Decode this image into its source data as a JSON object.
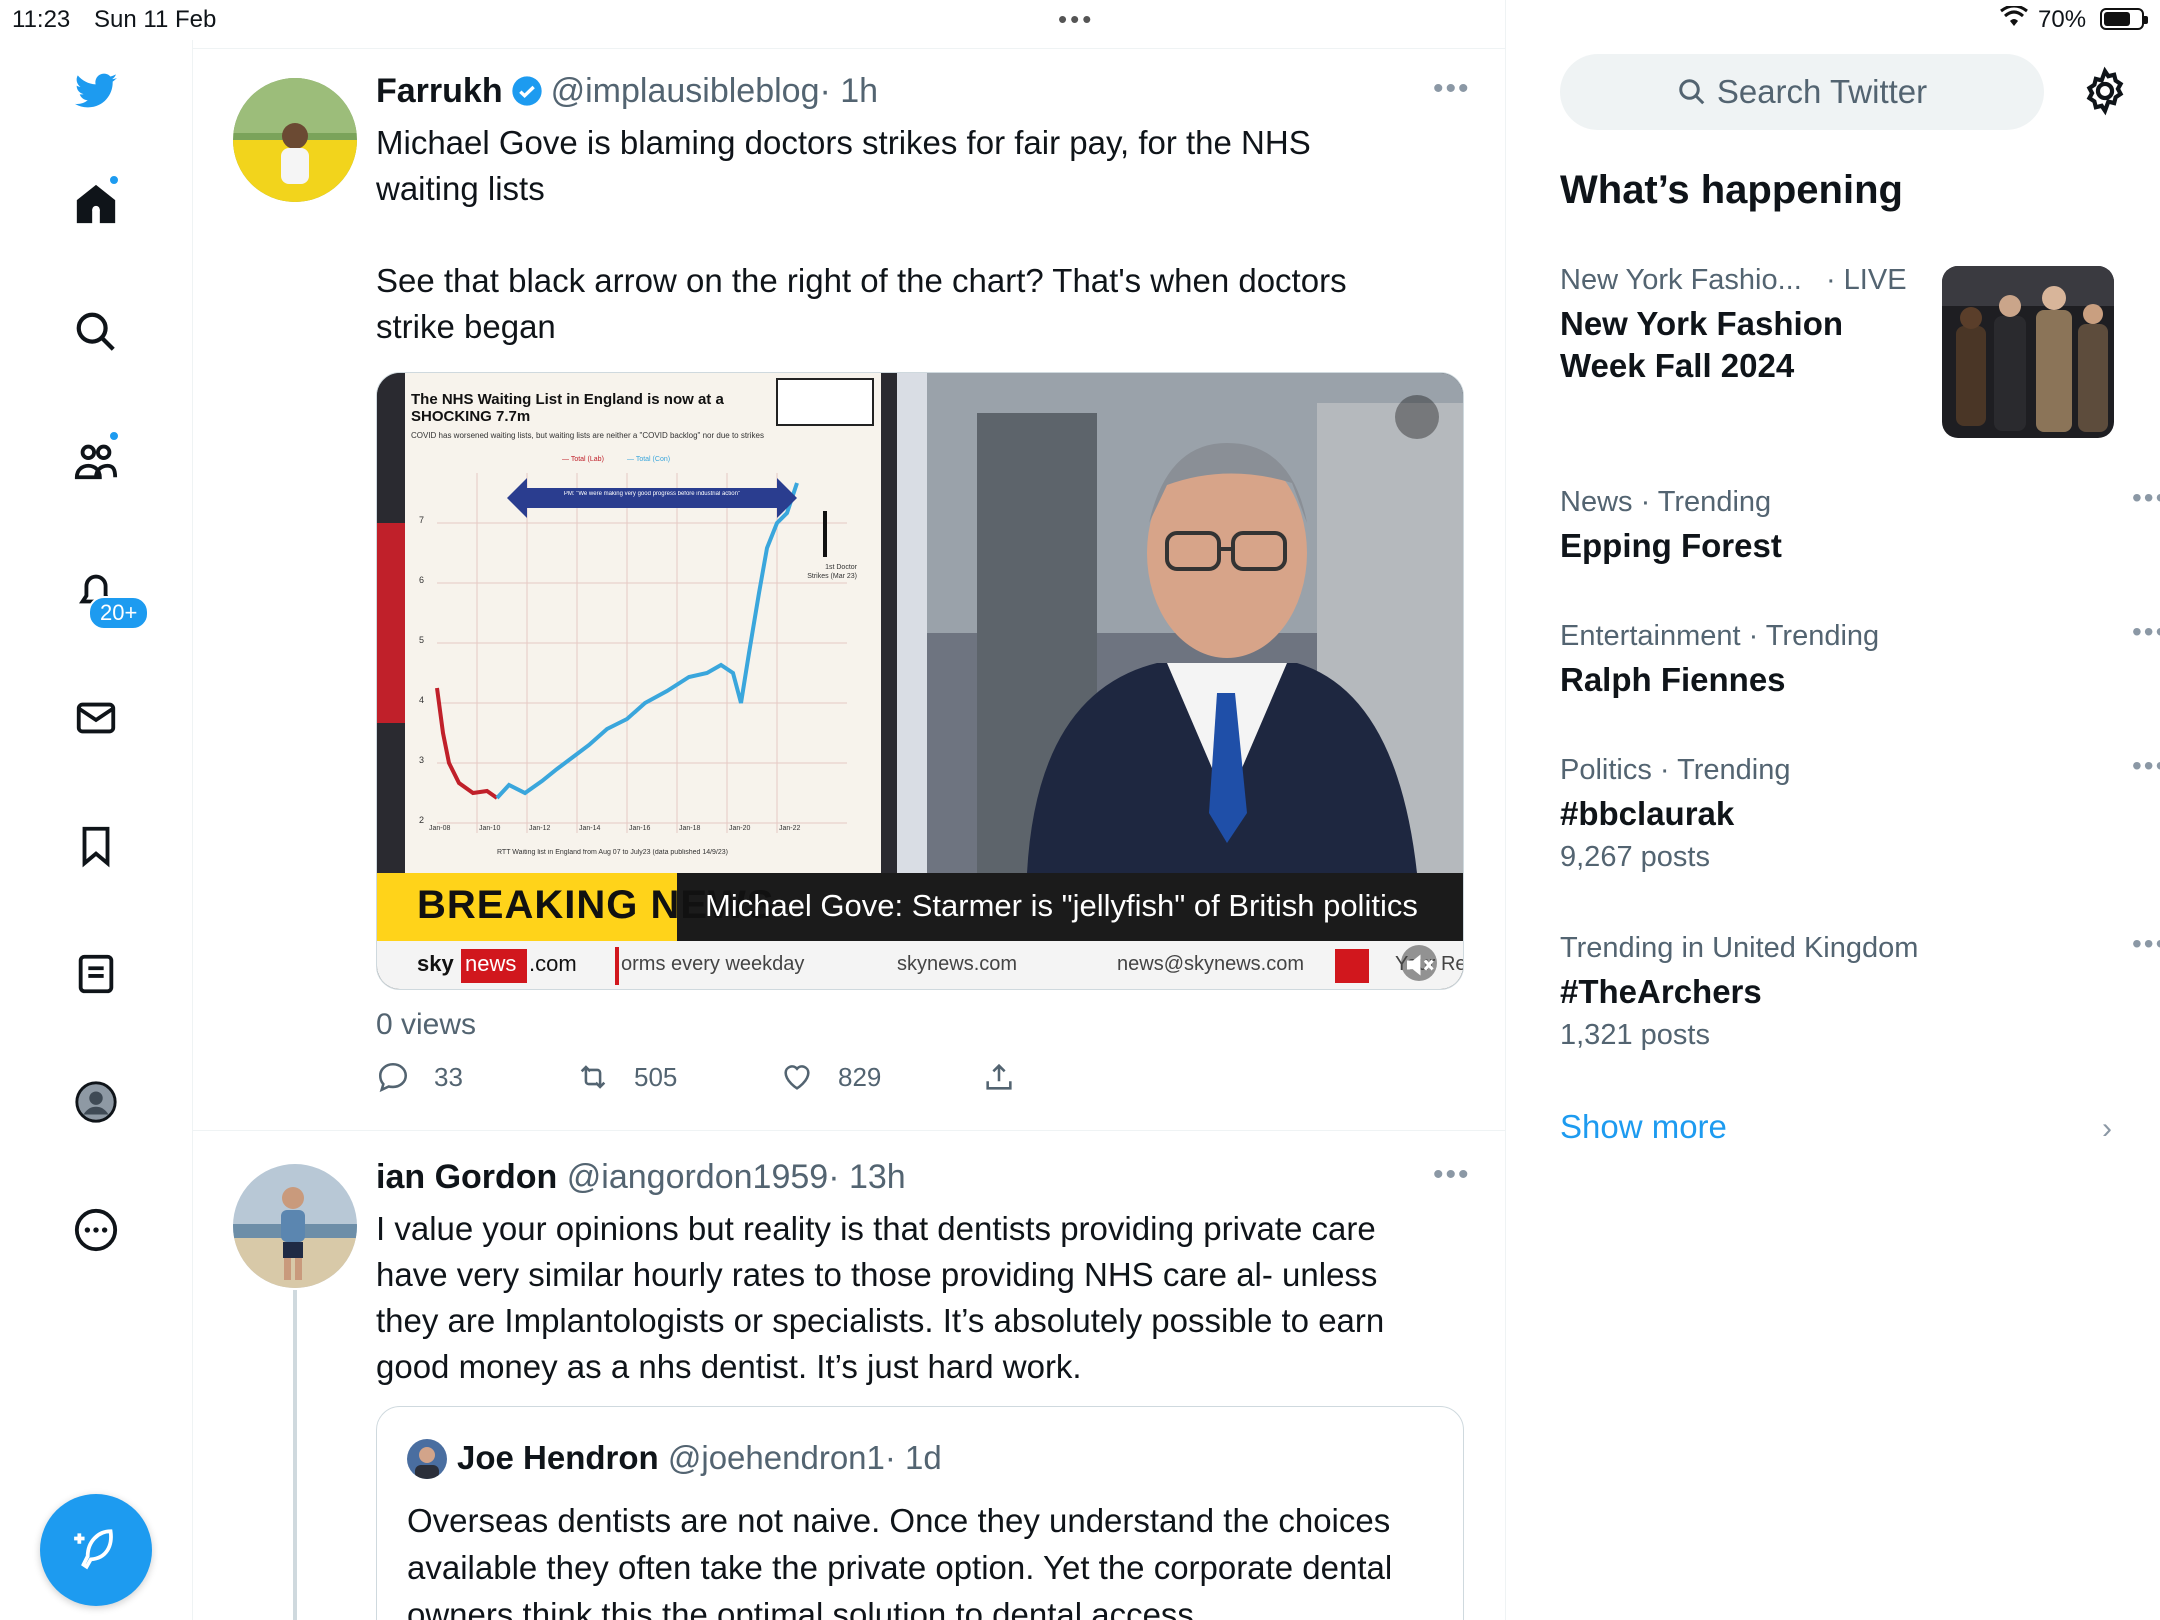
{
  "status_bar": {
    "time": "11:23",
    "date": "Sun 11 Feb",
    "battery": "70%"
  },
  "nav": {
    "notifications_badge": "20+"
  },
  "tweets": [
    {
      "name": "Farrukh",
      "handle": "@implausibleblog",
      "time": "· 1h",
      "text": "Michael Gove is blaming doctors strikes for fair pay, for the NHS\nwaiting lists\n\nSee that black arrow on the right of the chart? That's when doctors\nstrike began",
      "views": "0 views",
      "replies": "33",
      "retweets": "505",
      "likes": "829",
      "media": {
        "chart_title": "The NHS Waiting List in England is now at a SHOCKING 7.7m",
        "chart_subtitle": "COVID has worsened waiting lists, but waiting lists are neither a \"COVID backlog\" nor due to strikes",
        "legend_lab": "Total (Lab)",
        "legend_con": "Total (Con)",
        "arrow_label": "PM: \"We were making very good progress before industrial action\"",
        "strike_label": "1st Doctor Strikes (Mar 23)",
        "x_ticks": [
          "Jan-08",
          "Jan-10",
          "Jan-12",
          "Jan-14",
          "Jan-16",
          "Jan-18",
          "Jan-20",
          "Jan-22"
        ],
        "y_ticks": [
          "7",
          "6",
          "5",
          "4",
          "3",
          "2"
        ],
        "source": "RTT Waiting list in England from Aug 07 to July23 (data published 14/9/23)",
        "breaking": "BREAKING NEWS",
        "headline": "Michael Gove: Starmer is \"jellyfish\" of British politics",
        "ticker_brand": "sky",
        "ticker_news": "news",
        "ticker_com": ".com",
        "ticker_1": "orms every weekday",
        "ticker_2": "skynews.com",
        "ticker_3": "news@skynews.com",
        "ticker_4": "Your Re"
      }
    },
    {
      "name": "ian Gordon",
      "handle": "@iangordon1959",
      "time": "· 13h",
      "text": "I value your opinions but reality is that dentists providing private care\nhave very similar hourly rates to those providing NHS care al- unless\nthey are Implantologists or specialists. It’s absolutely possible to earn\ngood money as a nhs dentist. It’s just hard work.",
      "quote": {
        "name": "Joe Hendron",
        "handle": "@joehendron1",
        "time": "· 1d",
        "text": "Overseas dentists are not naive. Once they understand the choices available they often take the private option. Yet the corporate dental owners think this the optimal solution to dental access."
      }
    }
  ],
  "sidebar": {
    "search_placeholder": "Search Twitter",
    "heading": "What’s happening",
    "featured": {
      "category": "New York Fashio...",
      "live": "· LIVE",
      "title": "New York Fashion Week Fall 2024"
    },
    "trends": [
      {
        "category": "News · Trending",
        "title": "Epping Forest",
        "posts": ""
      },
      {
        "category": "Entertainment · Trending",
        "title": "Ralph Fiennes",
        "posts": ""
      },
      {
        "category": "Politics · Trending",
        "title": "#bbclaurak",
        "posts": "9,267 posts"
      },
      {
        "category": "Trending in United Kingdom",
        "title": "#TheArchers",
        "posts": "1,321 posts"
      }
    ],
    "show_more": "Show more"
  },
  "colors": {
    "accent": "#1d9bf0",
    "text": "#0f1419",
    "muted": "#536471"
  }
}
